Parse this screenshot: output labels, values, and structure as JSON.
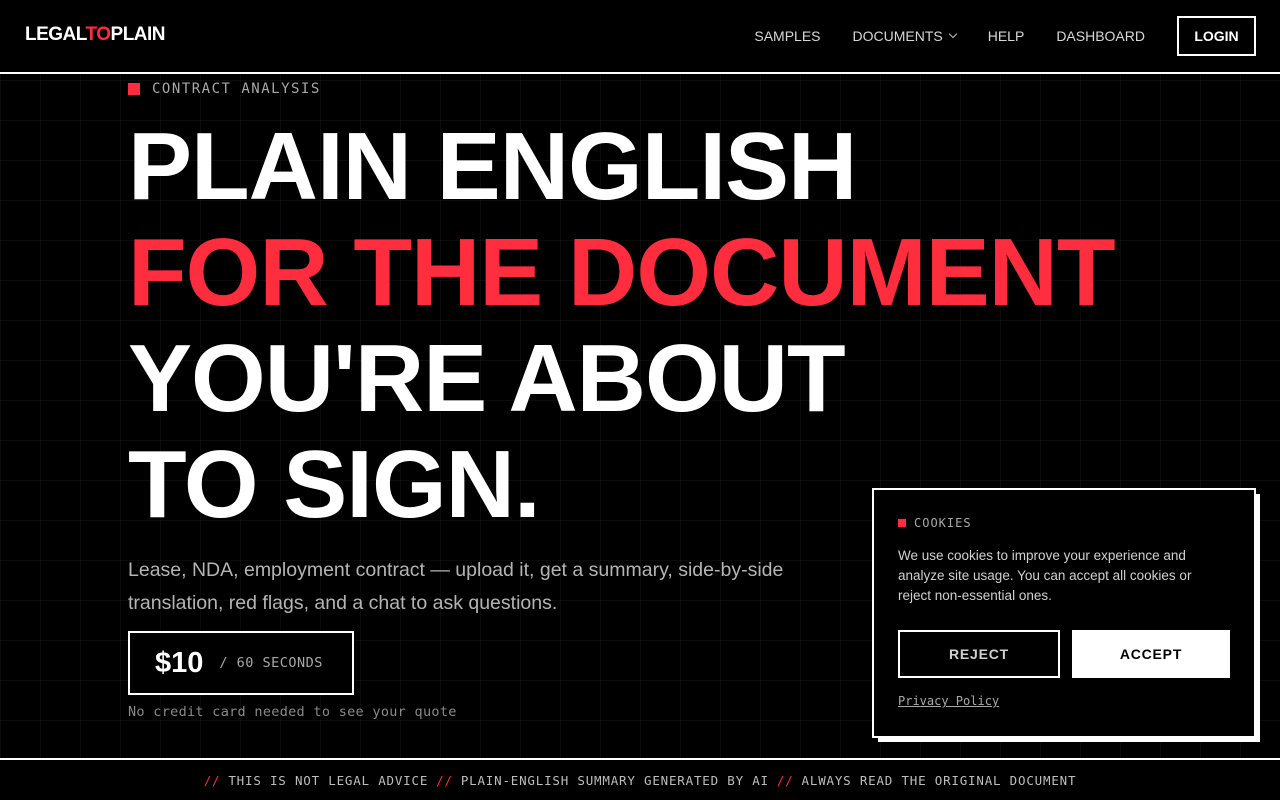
{
  "header": {
    "logo": {
      "part1": "LEGAL",
      "part2": "TO",
      "part3": "PLAIN"
    },
    "nav": {
      "samples": "SAMPLES",
      "documents": "DOCUMENTS",
      "help": "HELP",
      "dashboard": "DASHBOARD"
    },
    "login_label": "LOGIN"
  },
  "hero": {
    "kicker": "CONTRACT ANALYSIS",
    "headline": {
      "line1": "PLAIN ENGLISH",
      "line2": "FOR THE DOCUMENT",
      "line3": "YOU'RE ABOUT",
      "line4": "TO SIGN."
    },
    "subtitle": "Lease, NDA, employment contract — upload it, get a summary, side-by-side translation, red flags, and a chat to ask questions.",
    "price": "$10",
    "price_unit": "/ 60 SECONDS",
    "quote_note": "No credit card needed to see your quote"
  },
  "cookie": {
    "title": "COOKIES",
    "body": "We use cookies to improve your experience and analyze site usage. You can accept all cookies or reject non-essential ones.",
    "reject_label": "REJECT",
    "accept_label": "ACCEPT",
    "privacy_link": "Privacy Policy"
  },
  "footer": {
    "separator": "//",
    "items": [
      "THIS IS NOT LEGAL ADVICE",
      "PLAIN-ENGLISH SUMMARY GENERATED BY AI",
      "ALWAYS READ THE ORIGINAL DOCUMENT"
    ]
  },
  "colors": {
    "accent": "#ff2d3d",
    "background": "#000000",
    "foreground": "#ffffff"
  }
}
